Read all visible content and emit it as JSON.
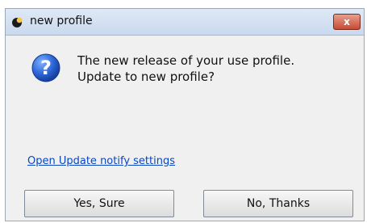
{
  "window": {
    "title": "new profile",
    "close_label": "x"
  },
  "dialog": {
    "message_line1": "The new release of your use profile.",
    "message_line2": "Update to new profile?",
    "settings_link": "Open Update notify settings"
  },
  "buttons": {
    "yes_label": "Yes, Sure",
    "no_label": "No, Thanks"
  },
  "colors": {
    "link": "#0a46c2",
    "close_button": "#c74b34",
    "question_icon": "#1f5fd1"
  },
  "icons": {
    "app": "app-icon",
    "question": "question-icon",
    "close": "close-icon"
  }
}
